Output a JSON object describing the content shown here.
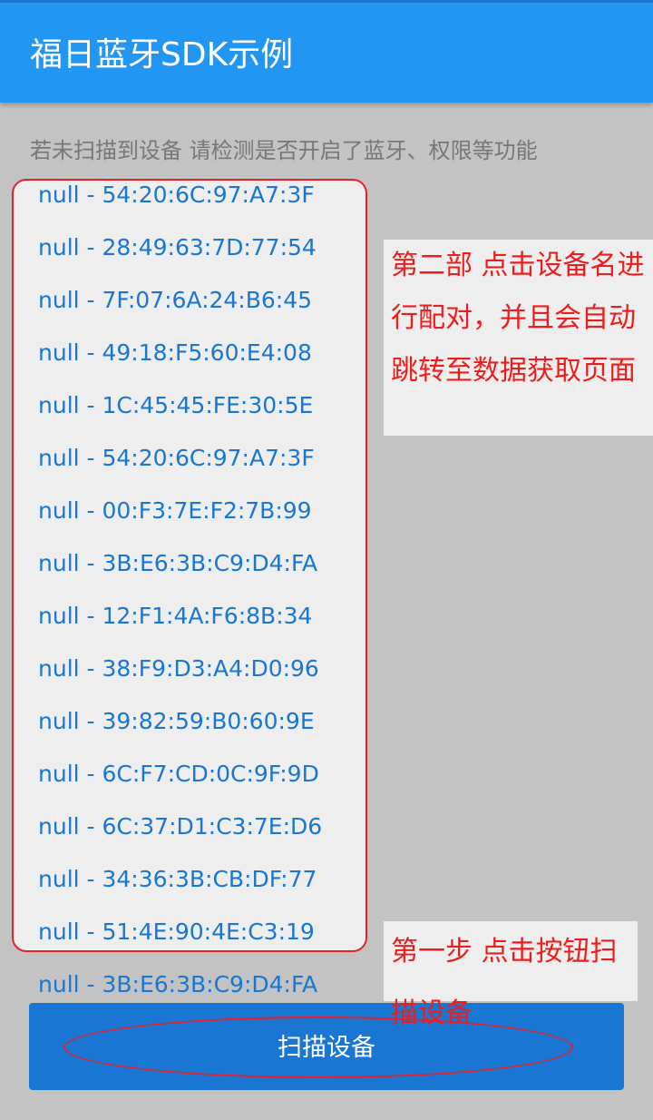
{
  "app_bar": {
    "title": "福日蓝牙SDK示例"
  },
  "hint": "若未扫描到设备 请检测是否开启了蓝牙、权限等功能",
  "devices": [
    "null - 54:20:6C:97:A7:3F",
    "null - 28:49:63:7D:77:54",
    "null - 7F:07:6A:24:B6:45",
    "null - 49:18:F5:60:E4:08",
    "null - 1C:45:45:FE:30:5E",
    "null - 54:20:6C:97:A7:3F",
    "null - 00:F3:7E:F2:7B:99",
    "null - 3B:E6:3B:C9:D4:FA",
    "null - 12:F1:4A:F6:8B:34",
    "null - 38:F9:D3:A4:D0:96",
    "null - 39:82:59:B0:60:9E",
    "null - 6C:F7:CD:0C:9F:9D",
    "null - 6C:37:D1:C3:7E:D6",
    "null - 34:36:3B:CB:DF:77",
    "null - 51:4E:90:4E:C3:19",
    "null - 3B:E6:3B:C9:D4:FA"
  ],
  "annotations": {
    "step2": "第二部 点击设备名进行配对，并且会自动跳转至数据获取页面",
    "step1": "第一步 点击按钮扫描设备"
  },
  "scan_button": "扫描设备",
  "colors": {
    "primary": "#2196F3",
    "button": "#1976D2",
    "annotation": "#e82029"
  }
}
